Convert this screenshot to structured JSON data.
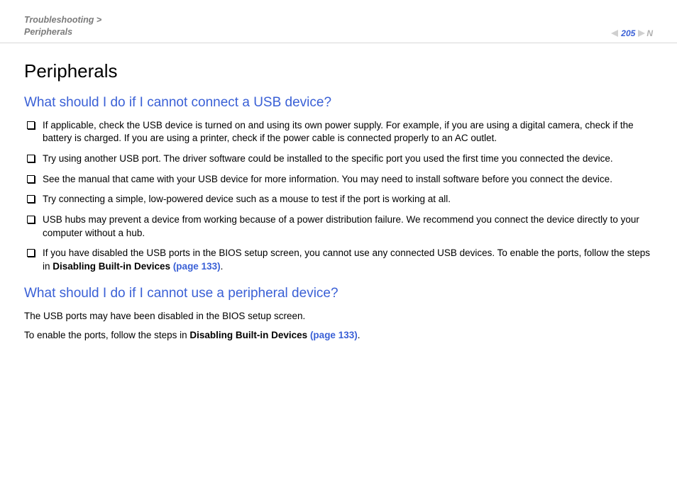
{
  "header": {
    "breadcrumb_line1": "Troubleshooting >",
    "breadcrumb_line2": "Peripherals",
    "page_number": "205",
    "nav_suffix": "N"
  },
  "title": "Peripherals",
  "section1": {
    "heading": "What should I do if I cannot connect a USB device?",
    "items": [
      "If applicable, check the USB device is turned on and using its own power supply. For example, if you are using a digital camera, check if the battery is charged. If you are using a printer, check if the power cable is connected properly to an AC outlet.",
      "Try using another USB port. The driver software could be installed to the specific port you used the first time you connected the device.",
      "See the manual that came with your USB device for more information. You may need to install software before you connect the device.",
      "Try connecting a simple, low-powered device such as a mouse to test if the port is working at all.",
      "USB hubs may prevent a device from working because of a power distribution failure. We recommend you connect the device directly to your computer without a hub."
    ],
    "item6_pre": "If you have disabled the USB ports in the BIOS setup screen, you cannot use any connected USB devices. To enable the ports, follow the steps in ",
    "item6_bold": "Disabling Built-in Devices ",
    "item6_link": "(page 133)",
    "item6_post": "."
  },
  "section2": {
    "heading": "What should I do if I cannot use a peripheral device?",
    "p1": "The USB ports may have been disabled in the BIOS setup screen.",
    "p2_pre": "To enable the ports, follow the steps in ",
    "p2_bold": "Disabling Built-in Devices ",
    "p2_link": "(page 133)",
    "p2_post": "."
  }
}
